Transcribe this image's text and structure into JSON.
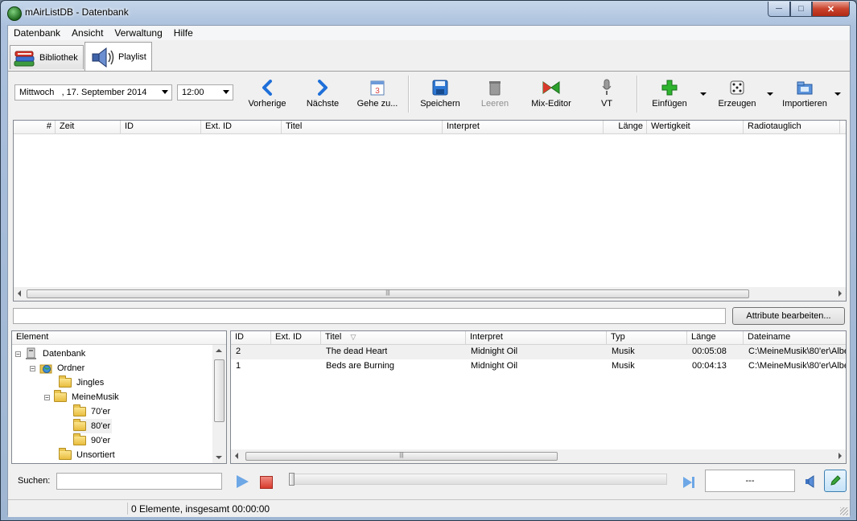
{
  "window": {
    "title": "mAirListDB - Datenbank"
  },
  "menu": {
    "items": [
      "Datenbank",
      "Ansicht",
      "Verwaltung",
      "Hilfe"
    ]
  },
  "tabs": [
    {
      "label": "Bibliothek",
      "icon": "books-icon"
    },
    {
      "label": "Playlist",
      "icon": "speaker-icon",
      "active": true
    }
  ],
  "toolbar": {
    "date_value": "Mittwoch   , 17. September 2014",
    "time_value": "12:00",
    "buttons": {
      "prev": "Vorherige",
      "next": "Nächste",
      "goto": "Gehe zu...",
      "save": "Speichern",
      "clear": "Leeren",
      "mix": "Mix-Editor",
      "vt": "VT",
      "insert": "Einfügen",
      "generate": "Erzeugen",
      "import": "Importieren"
    }
  },
  "playlist": {
    "columns": [
      "#",
      "Zeit",
      "ID",
      "Ext. ID",
      "Titel",
      "Interpret",
      "Länge",
      "Wertigkeit",
      "Radiotauglich"
    ]
  },
  "attributes_button": "Attribute bearbeiten...",
  "tree": {
    "header": "Element",
    "items": [
      {
        "label": "Datenbank",
        "level": 0,
        "expander": "−",
        "icon": "database-icon"
      },
      {
        "label": "Ordner",
        "level": 1,
        "expander": "−",
        "icon": "globe-folder-icon"
      },
      {
        "label": "Jingles",
        "level": 2,
        "expander": "",
        "icon": "folder-icon"
      },
      {
        "label": "MeineMusik",
        "level": 2,
        "expander": "−",
        "icon": "folder-icon"
      },
      {
        "label": "70'er",
        "level": 3,
        "expander": "",
        "icon": "folder-icon"
      },
      {
        "label": "80'er",
        "level": 3,
        "expander": "",
        "icon": "folder-icon",
        "selected": true
      },
      {
        "label": "90'er",
        "level": 3,
        "expander": "",
        "icon": "folder-icon"
      },
      {
        "label": "Unsortiert",
        "level": 2,
        "expander": "",
        "icon": "folder-icon"
      }
    ]
  },
  "library": {
    "columns": [
      "ID",
      "Ext. ID",
      "Titel",
      "Interpret",
      "Typ",
      "Länge",
      "Dateiname"
    ],
    "rows": [
      {
        "id": "2",
        "ext_id": "",
        "title": "The dead Heart",
        "artist": "Midnight Oil",
        "type": "Musik",
        "length": "00:05:08",
        "file": "C:\\MeineMusik\\80'er\\Albe"
      },
      {
        "id": "1",
        "ext_id": "",
        "title": "Beds are Burning",
        "artist": "Midnight Oil",
        "type": "Musik",
        "length": "00:04:13",
        "file": "C:\\MeineMusik\\80'er\\Albe"
      }
    ]
  },
  "search": {
    "label": "Suchen:",
    "value": ""
  },
  "player": {
    "time": "---"
  },
  "status": {
    "text": "0 Elemente, insgesamt 00:00:00"
  }
}
